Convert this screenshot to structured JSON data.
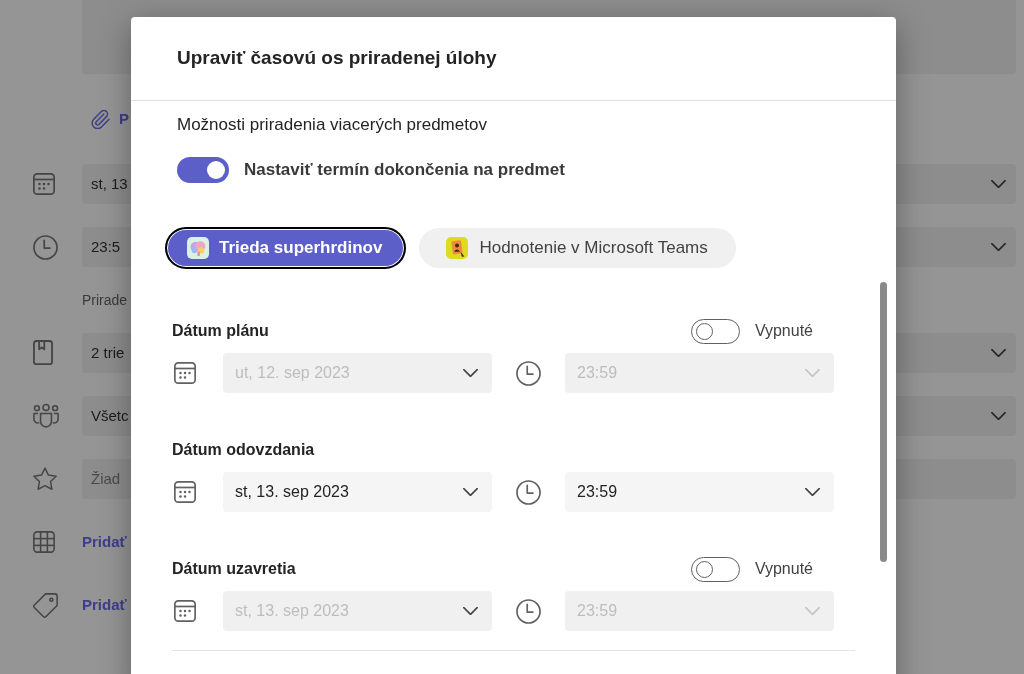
{
  "background": {
    "rows": [
      {
        "kind": "attachment",
        "text": "P"
      },
      {
        "kind": "dropdown",
        "value": "st, 13"
      },
      {
        "kind": "dropdown",
        "value": "23:5"
      },
      {
        "kind": "caption",
        "text": "Prirade"
      },
      {
        "kind": "dropdown",
        "value": "2 trie"
      },
      {
        "kind": "dropdown",
        "value": "Všetc"
      },
      {
        "kind": "input",
        "placeholder": "Žiad"
      },
      {
        "kind": "link",
        "text": "Pridať"
      },
      {
        "kind": "link",
        "text": "Pridať"
      }
    ]
  },
  "dialog": {
    "title": "Upraviť časovú os priradenej úlohy",
    "section_title": "Možnosti priradenia viacerých predmetov",
    "per_class_toggle": {
      "label": "Nastaviť termín dokončenia na predmet",
      "on": true
    },
    "classes": [
      {
        "name": "Trieda superhrdinov",
        "selected": true
      },
      {
        "name": "Hodnotenie v Microsoft Teams",
        "selected": false
      }
    ],
    "dates": [
      {
        "label": "Dátum plánu",
        "toggle": {
          "label": "Vypnuté",
          "on": false
        },
        "date": {
          "value": "ut, 12. sep 2023",
          "disabled": true
        },
        "time": {
          "value": "23:59",
          "disabled": true
        }
      },
      {
        "label": "Dátum odovzdania",
        "date": {
          "value": "st, 13. sep 2023",
          "disabled": false
        },
        "time": {
          "value": "23:59",
          "disabled": false
        }
      },
      {
        "label": "Dátum uzavretia",
        "toggle": {
          "label": "Vypnuté",
          "on": false
        },
        "date": {
          "value": "st, 13. sep 2023",
          "disabled": true
        },
        "time": {
          "value": "23:59",
          "disabled": true
        }
      }
    ]
  }
}
